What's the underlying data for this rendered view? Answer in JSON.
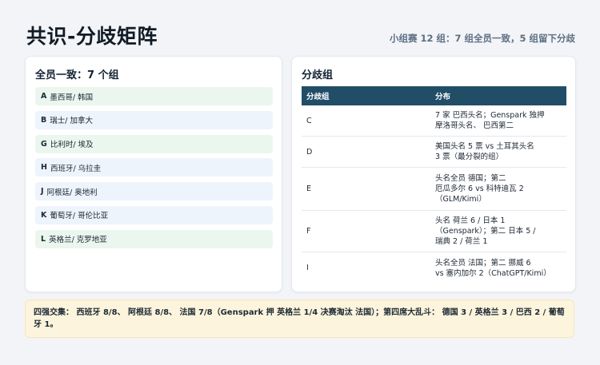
{
  "header": {
    "title": "共识-分歧矩阵",
    "subtitle": "小组赛 12 组：7 组全员一致，5 组留下分歧"
  },
  "consensus": {
    "title": "全员一致：7 个组",
    "items": [
      {
        "group": "A",
        "text": "墨西哥/ 韩国",
        "flags": [
          "mexico",
          "korea"
        ]
      },
      {
        "group": "B",
        "text": "瑞士/ 加拿大",
        "flags": [
          "switzerland",
          "canada"
        ]
      },
      {
        "group": "G",
        "text": "比利时/ 埃及",
        "flags": [
          "belgium",
          "egypt"
        ]
      },
      {
        "group": "H",
        "text": "西班牙/ 乌拉圭",
        "flags": [
          "spain",
          "uruguay"
        ]
      },
      {
        "group": "J",
        "text": "阿根廷/ 奥地利",
        "flags": [
          "argentina",
          "austria"
        ]
      },
      {
        "group": "K",
        "text": "葡萄牙/ 哥伦比亚",
        "flags": [
          "portugal",
          "colombia"
        ]
      },
      {
        "group": "L",
        "text": "英格兰/ 克罗地亚",
        "flags": [
          "england",
          "croatia"
        ]
      }
    ]
  },
  "divergence": {
    "title": "分歧组",
    "col_group": "分歧组",
    "col_dist": "分布",
    "rows": [
      {
        "group": "C",
        "lines": [
          "7 家 巴西头名；Genspark 独押",
          " 摩洛哥头名、 巴西第二"
        ]
      },
      {
        "group": "D",
        "lines": [
          " 美国头名 5 票 vs  土耳其头名",
          "3 票（最分裂的组）"
        ]
      },
      {
        "group": "E",
        "lines": [
          "头名全员 德国；第二",
          " 厄瓜多尔 6 vs  科特迪瓦 2",
          "（GLM/Kimi）"
        ]
      },
      {
        "group": "F",
        "lines": [
          "头名 荷兰 6 /  日本 1",
          "（Genspark）；第二 日本 5 /",
          " 瑞典 2 /  荷兰 1"
        ]
      },
      {
        "group": "I",
        "lines": [
          "头名全员 法国；第二 挪威 6",
          "vs  塞内加尔 2（ChatGPT/Kimi）"
        ]
      }
    ]
  },
  "footer": {
    "text": "四强交集： 西班牙 8/8、 阿根廷 8/8、 法国 7/8（Genspark 押 英格兰 1/4 决赛淘汰 法国）；第四席大乱斗： 德国 3 / 英格兰 3 /  巴西 2 /  葡萄牙 1。"
  }
}
